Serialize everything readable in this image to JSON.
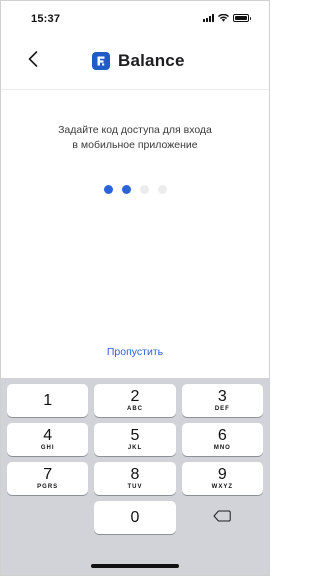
{
  "status_bar": {
    "time": "15:37"
  },
  "header": {
    "brand_letter": "F",
    "brand_name": "Balance"
  },
  "prompt": {
    "line1": "Задайте код доступа для входа",
    "line2": "в мобильное приложение"
  },
  "pin": {
    "length": 4,
    "entered": 2
  },
  "skip_label": "Пропустить",
  "keypad": {
    "keys": [
      {
        "digit": "1",
        "letters": ""
      },
      {
        "digit": "2",
        "letters": "ABC"
      },
      {
        "digit": "3",
        "letters": "DEF"
      },
      {
        "digit": "4",
        "letters": "GHI"
      },
      {
        "digit": "5",
        "letters": "JKL"
      },
      {
        "digit": "6",
        "letters": "MNO"
      },
      {
        "digit": "7",
        "letters": "PGRS"
      },
      {
        "digit": "8",
        "letters": "TUV"
      },
      {
        "digit": "9",
        "letters": "WXYZ"
      },
      {
        "digit": "0",
        "letters": ""
      }
    ]
  },
  "colors": {
    "accent": "#2d63d8",
    "brand": "#1f5cc7",
    "keypad_background": "#d1d3d9",
    "empty_dot": "#ececec"
  },
  "icons": {
    "back": "chevron-left-icon",
    "delete": "backspace-icon",
    "signal": "cellular-signal-icon",
    "wifi": "wifi-icon",
    "battery": "battery-icon"
  }
}
